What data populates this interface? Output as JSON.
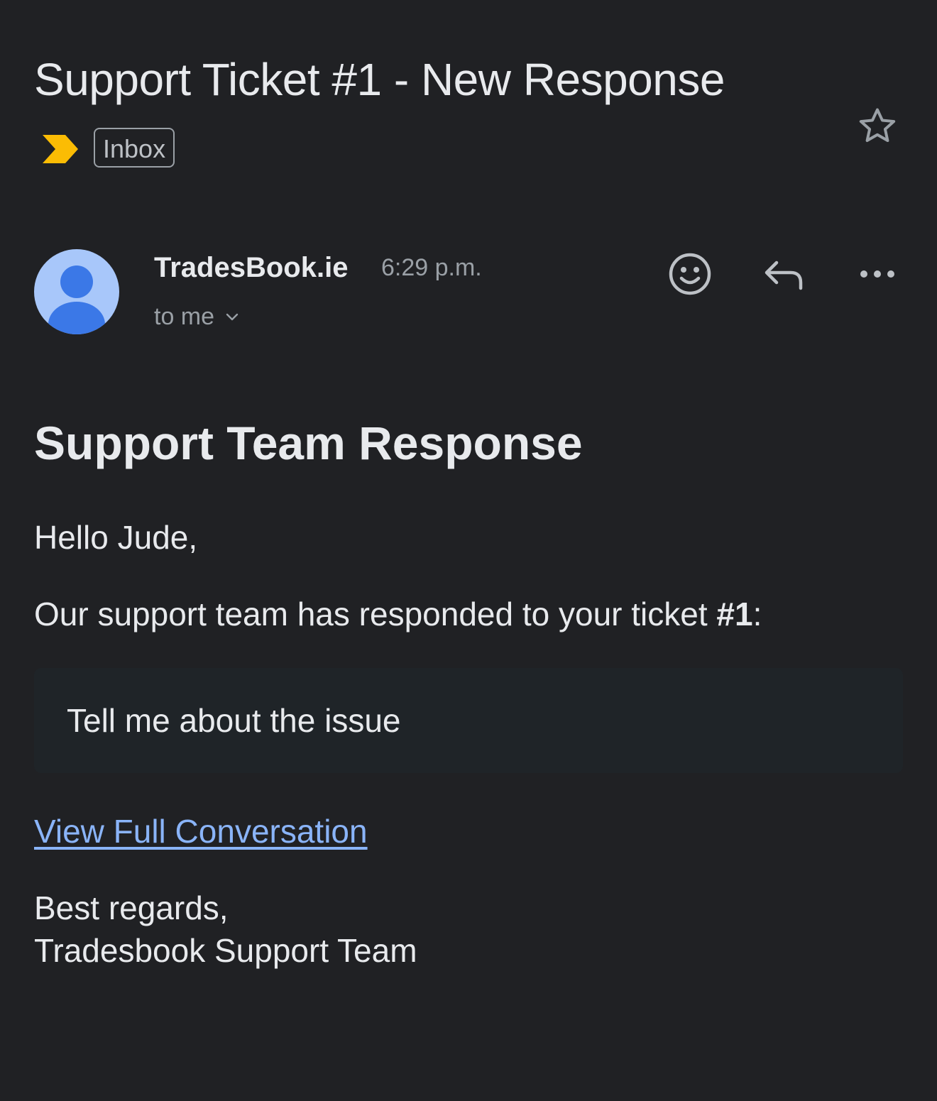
{
  "email": {
    "subject": "Support Ticket #1 - New Response",
    "label": "Inbox",
    "sender": "TradesBook.ie",
    "time": "6:29 p.m.",
    "recipient": "to me"
  },
  "body": {
    "heading": "Support Team Response",
    "greeting": "Hello Jude,",
    "intro_prefix": "Our support team has responded to your ticket ",
    "ticket_ref": "#1",
    "intro_suffix": ":",
    "response_text": "Tell me about the issue",
    "link_text": "View Full Conversation",
    "signoff_line1": "Best regards,",
    "signoff_line2": "Tradesbook Support Team"
  },
  "icons": {
    "star": "star-outline-icon",
    "importance": "importance-marker-icon",
    "emoji": "add-reaction-icon",
    "reply": "reply-icon",
    "more": "more-horizontal-icon",
    "chevron": "chevron-down-icon"
  },
  "colors": {
    "background": "#202124",
    "importance_marker": "#fbbc04",
    "avatar_bg": "#a8c7fa",
    "avatar_fg": "#3b78e7",
    "link": "#8ab4f8",
    "quote_bg": "#1f2428"
  }
}
